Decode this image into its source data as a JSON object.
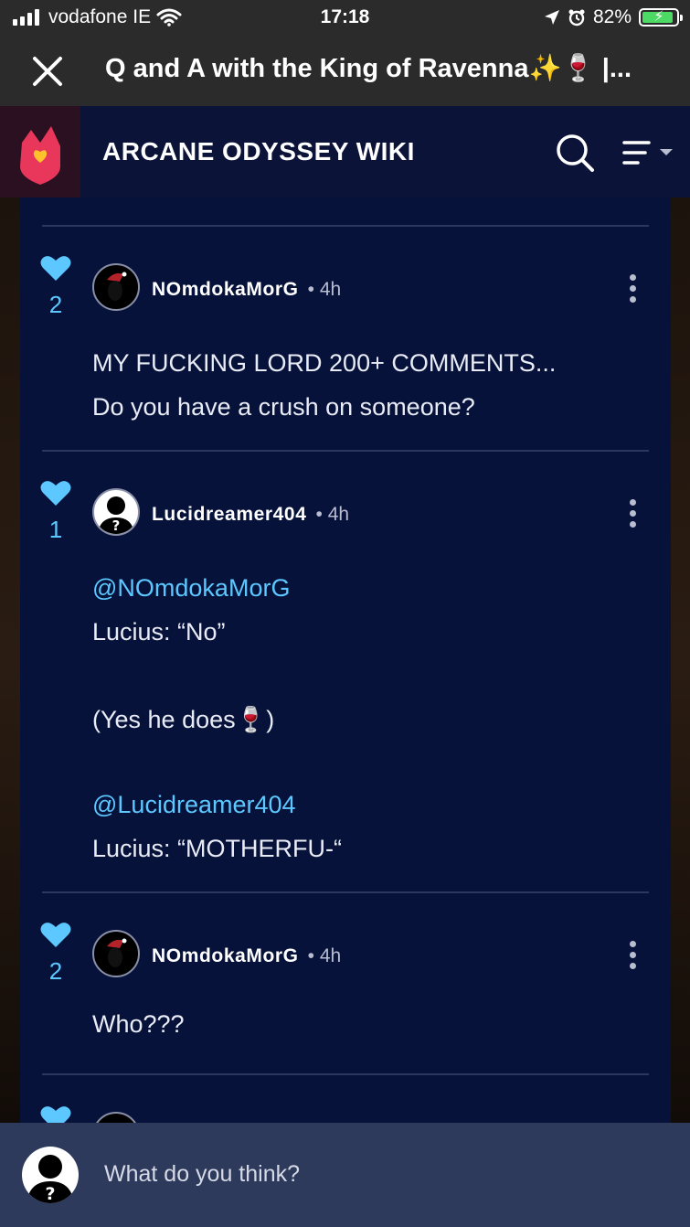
{
  "status_bar": {
    "carrier": "vodafone IE",
    "time": "17:18",
    "battery": "82%",
    "signal_bars": 4,
    "icons": [
      "wifi-icon",
      "location-arrow-icon",
      "alarm-icon",
      "battery-charging-icon"
    ]
  },
  "browser": {
    "title": "Q and A with the King of Ravenna✨🍷 |..."
  },
  "wiki": {
    "name": "ARCANE ODYSSEY WIKI"
  },
  "comments": [
    {
      "likes": "2",
      "username": "NOmdokaMorG",
      "time": "4h",
      "lines": [
        {
          "text": "MY FUCKING LORD 200+ COMMENTS...",
          "mention": false
        },
        {
          "text": "Do you have a crush on someone?",
          "mention": false
        }
      ]
    },
    {
      "likes": "1",
      "username": "Lucidreamer404",
      "time": "4h",
      "lines": [
        {
          "text": "@NOmdokaMorG",
          "mention": true
        },
        {
          "text": "Lucius: “No”",
          "mention": false
        },
        {
          "text": "(Yes he does🍷)",
          "mention": false
        },
        {
          "text": "@Lucidreamer404",
          "mention": true
        },
        {
          "text": "Lucius: “MOTHERFU-“",
          "mention": false
        }
      ]
    },
    {
      "likes": "2",
      "username": "NOmdokaMorG",
      "time": "4h",
      "lines": [
        {
          "text": "Who???",
          "mention": false
        }
      ]
    }
  ],
  "separator": "•",
  "composer": {
    "placeholder": "What do you think?"
  },
  "colors": {
    "like": "#5cc8ff",
    "mention": "#5cc8ff",
    "content_bg": "#06123a",
    "header_bg": "#0b1338",
    "composer_bg": "#2e3a5c",
    "fandom_flame": "#e8375a"
  }
}
